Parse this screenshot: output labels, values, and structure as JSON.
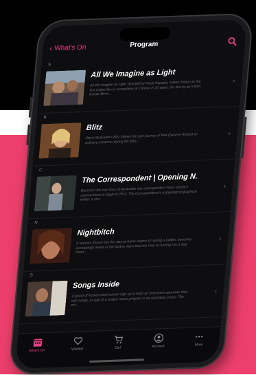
{
  "nav": {
    "back_label": "What's On",
    "title": "Program"
  },
  "sections": [
    {
      "letter": "A",
      "title": "All We Imagine as Light",
      "description": "All We Imagine as Light, directed by Payal Kapadia, makes history as the first Indian film in competition at Cannes in 30 years, the first by an Indian female filmm..."
    },
    {
      "letter": "B",
      "title": "Blitz",
      "description": "Steve McQueen's Blitz follows the epic journey of Rita (Saoirse Ronan) an ordinary Londoner during the Blitz..."
    },
    {
      "letter": "C",
      "title": "The Correspondent | Opening N...",
      "description": "Based on the true story of Australian war correspondent Peter Greste's imprisonment in Egypt in 2013, The Correspondent is a gripping biographical thriller, a stor..."
    },
    {
      "letter": "N",
      "title": "Nightbitch",
      "description": "A woman, thrown into the stay-at-home routine of raising a toddler, becomes increasingly aware of the bizarre signs that she may be turning into a dog. Starri..."
    },
    {
      "letter": "S",
      "title": "Songs Inside",
      "description": "A group of incarcerated women sign up to learn an instrument and write their own songs, as part of a unique music program in an Australian prison. The pro..."
    }
  ],
  "tabs": [
    {
      "label": "What's On",
      "icon": "calendar-icon",
      "active": true
    },
    {
      "label": "Wishlist",
      "icon": "heart-icon",
      "active": false
    },
    {
      "label": "Cart",
      "icon": "cart-icon",
      "active": false
    },
    {
      "label": "Account",
      "icon": "account-icon",
      "active": false
    },
    {
      "label": "More",
      "icon": "more-icon",
      "active": false
    }
  ],
  "colors": {
    "accent": "#e83f86",
    "background_pink": "#ec3f6c",
    "screen": "#0e0e10"
  }
}
